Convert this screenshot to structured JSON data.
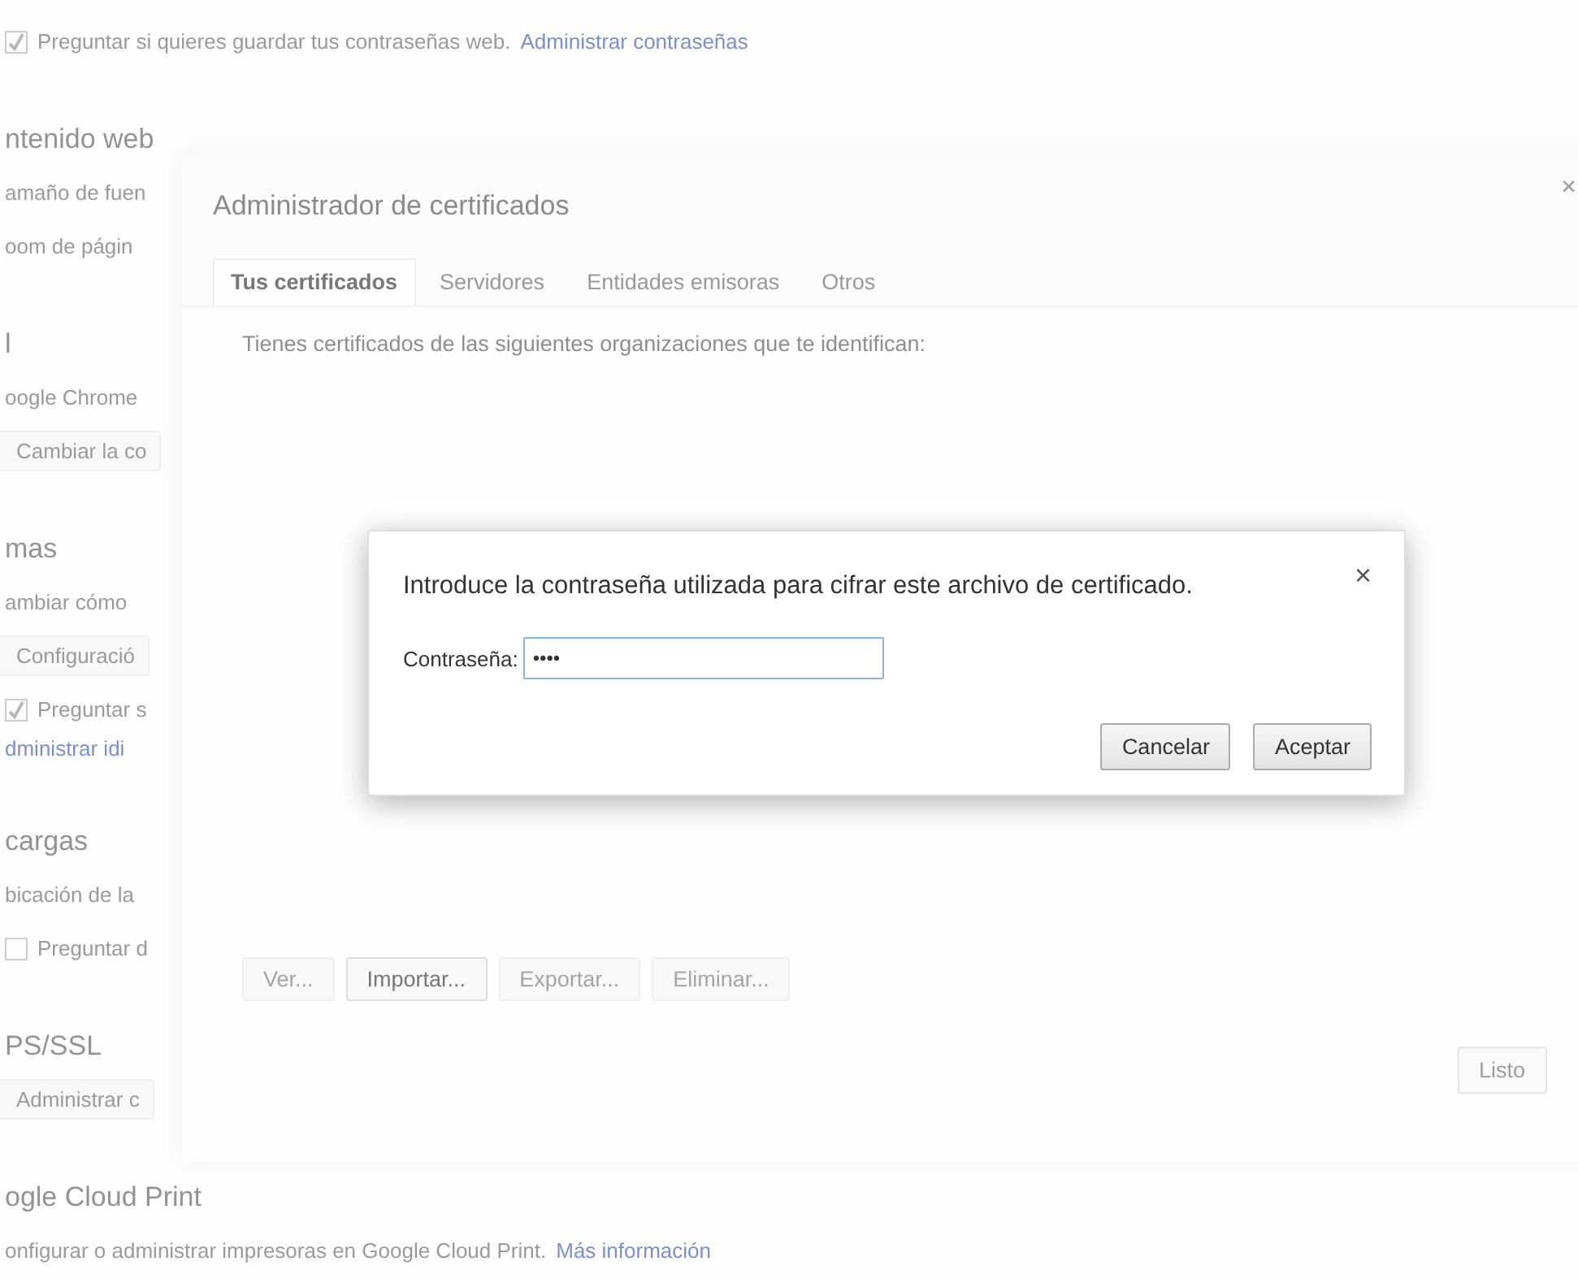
{
  "settings": {
    "items": [
      {
        "kind": "checkbox",
        "label": "Preguntar si quieres guardar tus contraseñas web.",
        "link": "Administrar contraseñas",
        "checked": true
      },
      {
        "kind": "heading",
        "label": "ntenido web"
      },
      {
        "kind": "text",
        "label": "amaño de fuen"
      },
      {
        "kind": "text",
        "label": "oom de págin"
      },
      {
        "kind": "heading",
        "label": "l"
      },
      {
        "kind": "text",
        "label": "oogle Chrome"
      },
      {
        "kind": "button",
        "label": "Cambiar la co"
      },
      {
        "kind": "heading",
        "label": "mas"
      },
      {
        "kind": "text",
        "label": "ambiar cómo"
      },
      {
        "kind": "button",
        "label": "Configuració"
      },
      {
        "kind": "checkbox",
        "label": "Preguntar s",
        "checked": true
      },
      {
        "kind": "link",
        "label": "dministrar idi"
      },
      {
        "kind": "heading",
        "label": "cargas"
      },
      {
        "kind": "text",
        "label": "bicación de la"
      },
      {
        "kind": "checkbox",
        "label": "Preguntar d",
        "checked": false
      },
      {
        "kind": "heading",
        "label": "PS/SSL"
      },
      {
        "kind": "button",
        "label": "Administrar c"
      },
      {
        "kind": "heading",
        "label": "ogle Cloud Print"
      },
      {
        "kind": "text",
        "label": "onfigurar o administrar impresoras en Google Cloud Print.",
        "link": "Más información"
      }
    ]
  },
  "certificate_manager": {
    "title": "Administrador de certificados",
    "close": "×",
    "tabs": [
      {
        "label": "Tus certificados",
        "selected": true
      },
      {
        "label": "Servidores",
        "selected": false
      },
      {
        "label": "Entidades emisoras",
        "selected": false
      },
      {
        "label": "Otros",
        "selected": false
      }
    ],
    "description": "Tienes certificados de las siguientes organizaciones que te identifican:",
    "buttons": [
      {
        "label": "Ver...",
        "disabled": true
      },
      {
        "label": "Importar...",
        "disabled": false
      },
      {
        "label": "Exportar...",
        "disabled": true
      },
      {
        "label": "Eliminar...",
        "disabled": true
      }
    ],
    "done_button": "Listo"
  },
  "password_dialog": {
    "message": "Introduce la contraseña utilizada para cifrar este archivo de certificado.",
    "close": "×",
    "field_label": "Contraseña:",
    "value": "••••",
    "buttons": [
      "Cancelar",
      "Aceptar"
    ]
  }
}
